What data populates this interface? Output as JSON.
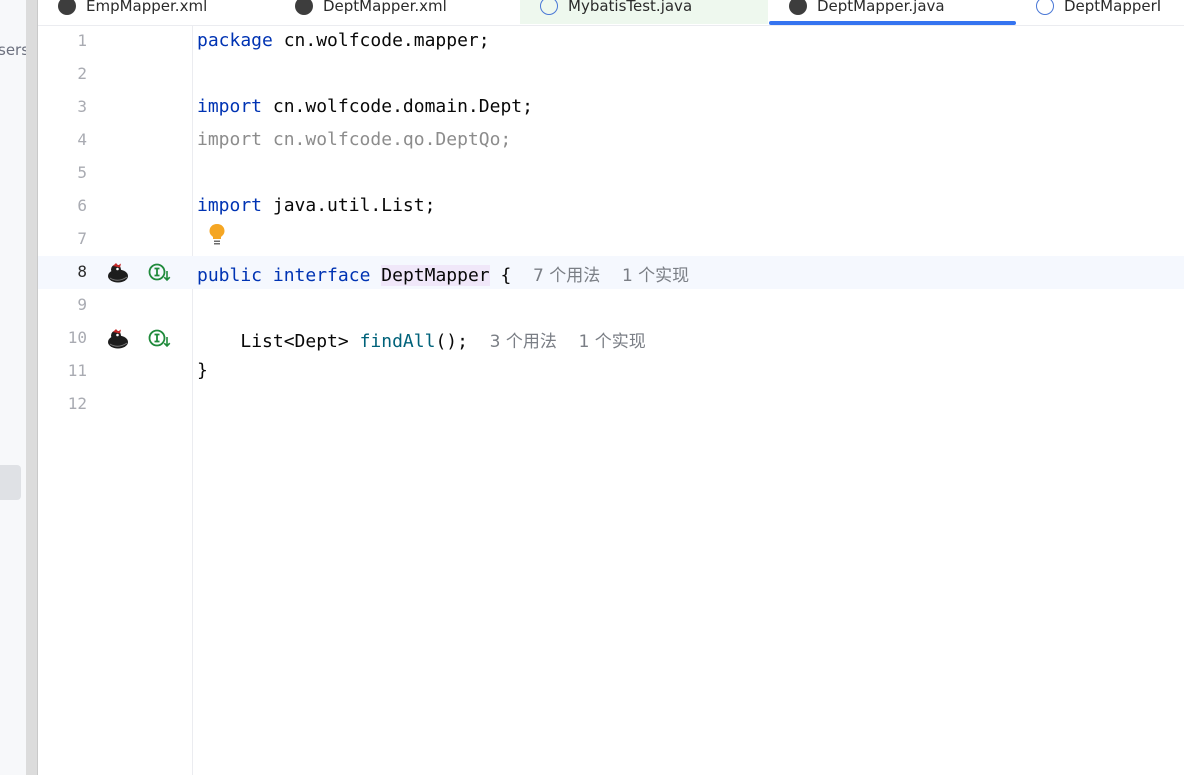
{
  "project_panel": {
    "path_fragment": "sers\\"
  },
  "tabs": [
    {
      "label": "EmpMapper.xml",
      "icon": "mybatis-xml-icon"
    },
    {
      "label": "DeptMapper.xml",
      "icon": "mybatis-xml-icon"
    },
    {
      "label": "MybatisTest.java",
      "icon": "java-class-icon"
    },
    {
      "label": "DeptMapper.java",
      "icon": "mybatis-interface-icon",
      "active": true
    },
    {
      "label": "DeptMapperI",
      "icon": "java-class-icon"
    }
  ],
  "editor": {
    "current_line": 8,
    "lines": {
      "l1": {
        "num": "1",
        "kw": "package",
        "rest": " cn.wolfcode.mapper;"
      },
      "l2": {
        "num": "2"
      },
      "l3": {
        "num": "3",
        "kw": "import",
        "rest": " cn.wolfcode.domain.Dept;"
      },
      "l4": {
        "num": "4",
        "text": "import cn.wolfcode.qo.DeptQo;"
      },
      "l5": {
        "num": "5"
      },
      "l6": {
        "num": "6",
        "kw": "import",
        "rest": " java.util.List;"
      },
      "l7": {
        "num": "7"
      },
      "l8": {
        "num": "8",
        "kw1": "public",
        "kw2": "interface",
        "name": "DeptMapper",
        "brace": " {",
        "hint_usages": "7 个用法",
        "hint_impls": "1 个实现"
      },
      "l9": {
        "num": "9"
      },
      "l10": {
        "num": "10",
        "type": "List<Dept> ",
        "method": "findAll",
        "rest": "();",
        "hint_usages": "3 个用法",
        "hint_impls": "1 个实现"
      },
      "l11": {
        "num": "11",
        "text": "}"
      },
      "l12": {
        "num": "12"
      }
    }
  },
  "colors": {
    "keyword": "#0033b3",
    "unused_import": "#8c8c8c",
    "method": "#00627a",
    "inlay_hint": "#7a7e85",
    "active_tab_underline": "#3574f0",
    "implementation_icon": "#1f8a3b",
    "bulb": "#f5a623"
  }
}
